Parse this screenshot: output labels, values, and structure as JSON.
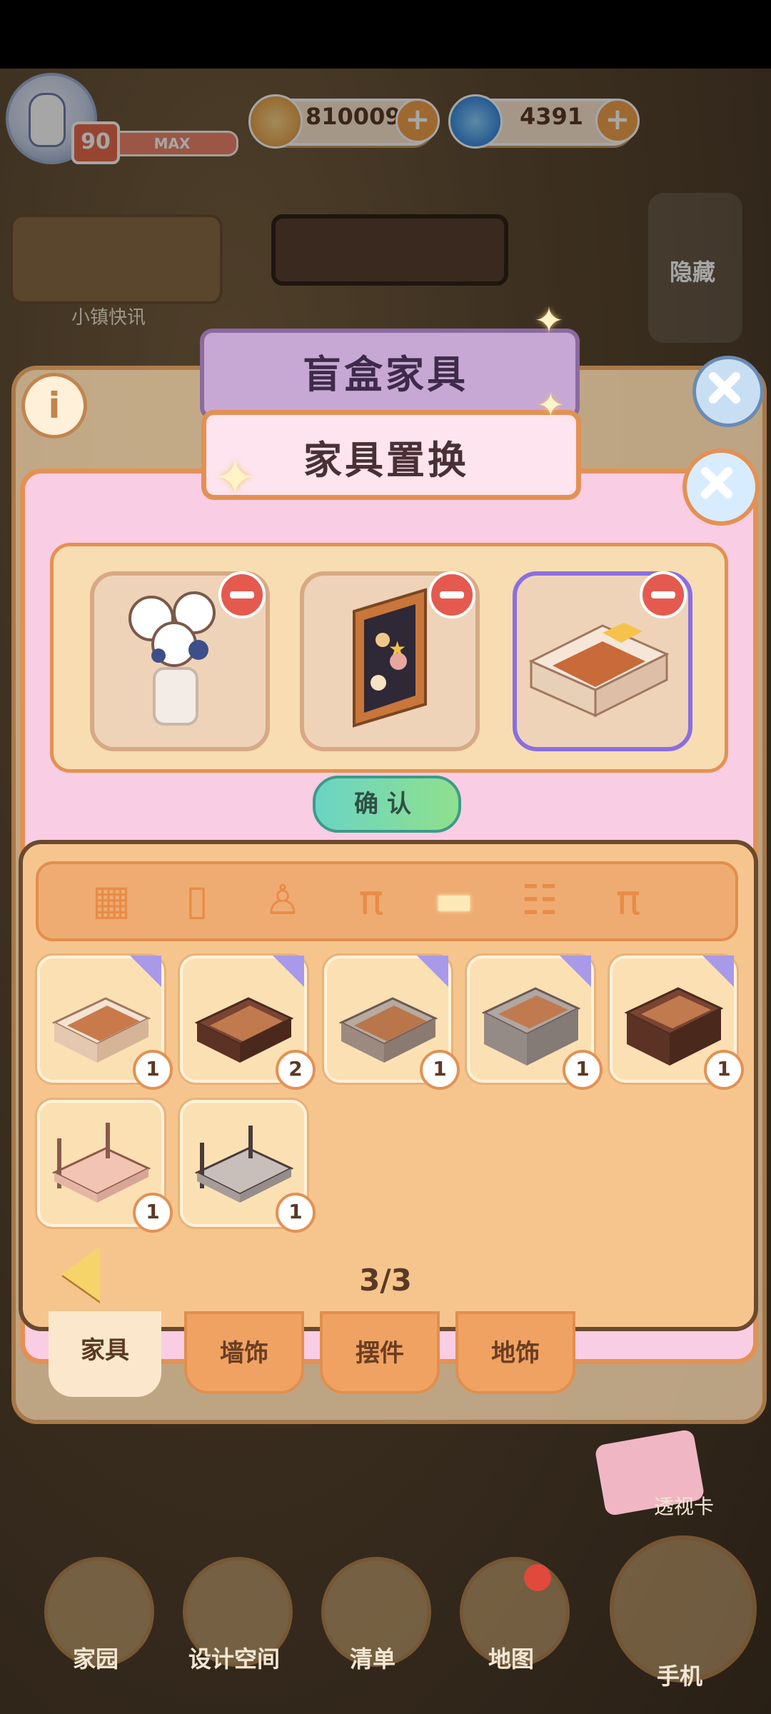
{
  "hud": {
    "level": "90",
    "level_bar_label": "MAX",
    "coins": "810009",
    "gems": "4391",
    "plus": "+"
  },
  "side": {
    "news_label": "小镇快讯",
    "hide_label": "隐藏"
  },
  "dialog": {
    "back_title": "盲盒家具",
    "title": "家具置换",
    "info_symbol": "i",
    "confirm_label": "确认",
    "selected_slots": [
      {
        "name": "vase-flowers"
      },
      {
        "name": "shell-frame"
      },
      {
        "name": "white-bed"
      }
    ]
  },
  "inventory": {
    "categories": [
      "grid-all",
      "fridge",
      "toilet",
      "stool",
      "bed",
      "cabinet",
      "table"
    ],
    "active_category": "bed",
    "items": [
      {
        "count": "1",
        "color": "#c87a4a"
      },
      {
        "count": "2",
        "color": "#6b3a2a"
      },
      {
        "count": "1",
        "color": "#b88a6a"
      },
      {
        "count": "1",
        "color": "#9a8a84"
      },
      {
        "count": "1",
        "color": "#7a4432"
      },
      {
        "count": "1",
        "color": "#e6b6a4"
      },
      {
        "count": "1",
        "color": "#a69c9a"
      }
    ],
    "page": "3/3"
  },
  "tabs": [
    "家具",
    "墙饰",
    "摆件",
    "地饰"
  ],
  "nav": {
    "home": "家园",
    "design": "设计空间",
    "list": "清单",
    "map": "地图",
    "phone": "手机",
    "xray": "透视卡"
  },
  "colors": {
    "accent": "#e39153",
    "dialog_pink": "#f9cde3",
    "selected_outline": "#8a6ee0"
  }
}
